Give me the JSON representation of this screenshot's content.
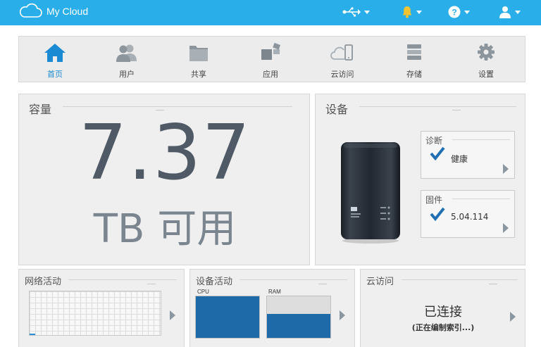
{
  "header": {
    "brand": "My Cloud",
    "colors": {
      "bar": "#2aaee9",
      "icon": "#ffffff",
      "bell": "#f4c430"
    },
    "icons": [
      "usb-icon",
      "bell-icon",
      "help-icon",
      "user-icon"
    ]
  },
  "nav": {
    "active": "home",
    "items": [
      {
        "id": "home",
        "label": "首页",
        "icon": "house-icon"
      },
      {
        "id": "users",
        "label": "用户",
        "icon": "users-icon"
      },
      {
        "id": "shares",
        "label": "共享",
        "icon": "folder-icon"
      },
      {
        "id": "apps",
        "label": "应用",
        "icon": "apps-icon"
      },
      {
        "id": "cloud",
        "label": "云访问",
        "icon": "cloud-device-icon"
      },
      {
        "id": "storage",
        "label": "存储",
        "icon": "storage-icon"
      },
      {
        "id": "settings",
        "label": "设置",
        "icon": "gear-icon"
      }
    ]
  },
  "capacity": {
    "title": "容量",
    "value": "7.37",
    "unit_text": "TB 可用"
  },
  "device": {
    "title": "设备",
    "diagnostics": {
      "title": "诊断",
      "value": "健康"
    },
    "firmware": {
      "title": "固件",
      "value": "5.04.114"
    }
  },
  "network": {
    "title": "网络活动"
  },
  "device_activity": {
    "title": "设备活动",
    "cpu": {
      "label": "CPU",
      "level": 1.0
    },
    "ram": {
      "label": "RAM",
      "level": 0.58
    }
  },
  "cloud_access": {
    "title": "云访问",
    "status": "已连接",
    "detail": "(正在编制索引...)"
  }
}
